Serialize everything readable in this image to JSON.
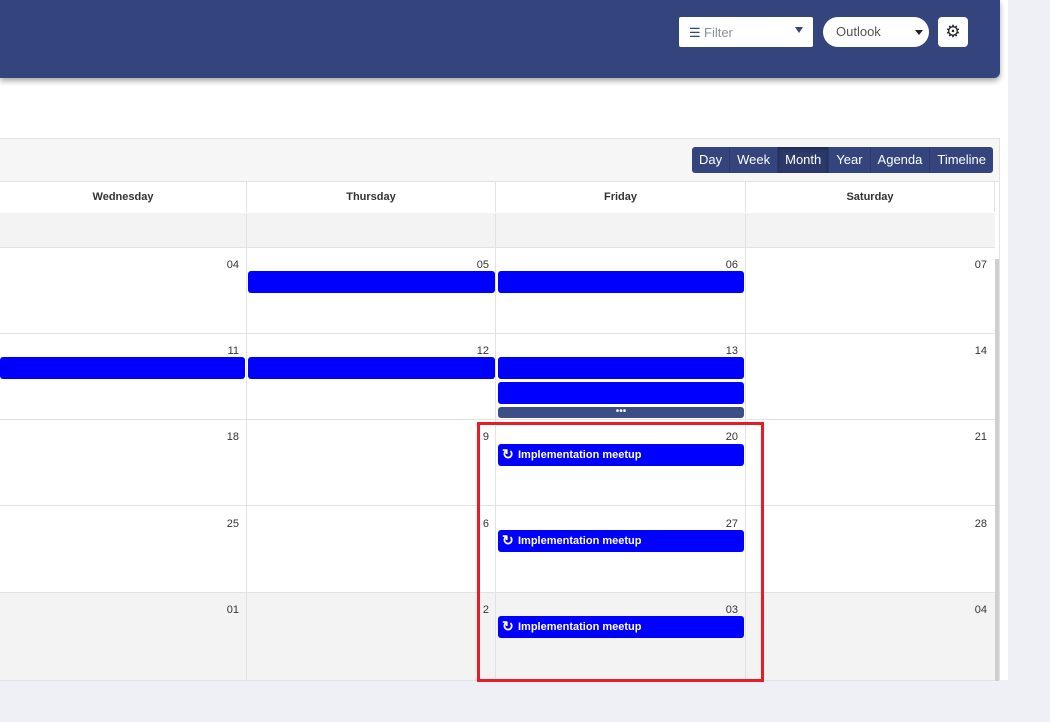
{
  "header": {
    "filter_label": "Filter",
    "calendar_select": "Outlook",
    "settings_icon": "gear-icon",
    "bar_color": "#34457d"
  },
  "views": [
    {
      "label": "Day"
    },
    {
      "label": "Week"
    },
    {
      "label": "Month",
      "active": true
    },
    {
      "label": "Year"
    },
    {
      "label": "Agenda"
    },
    {
      "label": "Timeline"
    }
  ],
  "day_headers": [
    "Wednesday",
    "Thursday",
    "Friday",
    "Saturday"
  ],
  "weeks": [
    {
      "days": [
        "04",
        "05",
        "06",
        "07"
      ]
    },
    {
      "days": [
        "11",
        "12",
        "13",
        "14"
      ]
    },
    {
      "days": [
        "18",
        "9",
        "20",
        "21"
      ]
    },
    {
      "days": [
        "25",
        "6",
        "27",
        "28"
      ]
    },
    {
      "days": [
        "01",
        "2",
        "03",
        "04"
      ]
    }
  ],
  "events": {
    "recurring_title": "Implementation meetup",
    "event_color": "#0000ff",
    "recurring_icon": "recurring-icon"
  },
  "more_label": "•••",
  "highlight_color": "#e81c24"
}
